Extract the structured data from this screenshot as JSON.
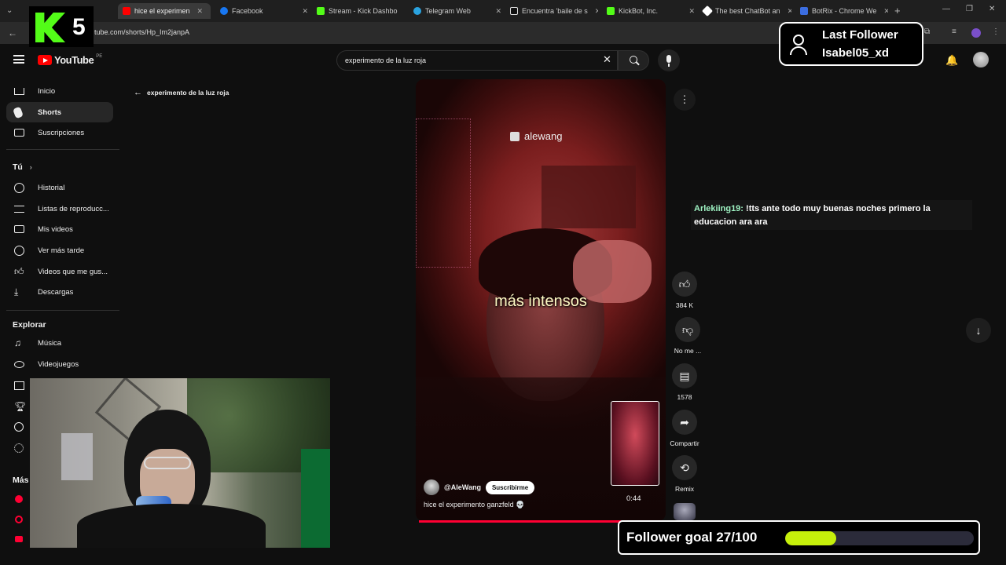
{
  "browser": {
    "tabs": [
      {
        "title": "hice el experimen",
        "active": true,
        "color": "#ff0000"
      },
      {
        "title": "Facebook",
        "active": false,
        "color": "#1877f2"
      },
      {
        "title": "Stream - Kick Dashbo",
        "active": false,
        "color": "#53fc18"
      },
      {
        "title": "Telegram Web",
        "active": false,
        "color": "#2aa3e0"
      },
      {
        "title": "Encuentra 'baile de s",
        "active": false,
        "color": "#111111"
      },
      {
        "title": "KickBot, Inc.",
        "active": false,
        "color": "#53fc18"
      },
      {
        "title": "The best ChatBot an",
        "active": false,
        "color": "#ffffff"
      },
      {
        "title": "BotRix - Chrome We",
        "active": false,
        "color": "#3b6de0"
      }
    ],
    "url": "tube.com/shorts/Hp_Im2janpA"
  },
  "header": {
    "logo_text": "YouTube",
    "logo_suffix": "PE",
    "search_value": "experimento de la luz roja"
  },
  "sidebar": {
    "items": [
      {
        "label": "Inicio",
        "icon": "home-icon"
      },
      {
        "label": "Shorts",
        "icon": "shorts-icon",
        "active": true
      },
      {
        "label": "Suscripciones",
        "icon": "subscriptions-icon"
      }
    ],
    "you_label": "Tú",
    "you_items": [
      {
        "label": "Historial",
        "icon": "history-icon"
      },
      {
        "label": "Listas de reproducc...",
        "icon": "playlist-icon"
      },
      {
        "label": "Mis videos",
        "icon": "my-videos-icon"
      },
      {
        "label": "Ver más tarde",
        "icon": "watch-later-icon"
      },
      {
        "label": "Videos que me gus...",
        "icon": "liked-icon"
      },
      {
        "label": "Descargas",
        "icon": "download-icon"
      }
    ],
    "explore_label": "Explorar",
    "explore_items": [
      {
        "label": "Música",
        "icon": "music-icon"
      },
      {
        "label": "Videojuegos",
        "icon": "gaming-icon"
      }
    ],
    "more_label": "Más"
  },
  "back_label": "experimento de la luz roja",
  "video": {
    "watermark": "alewang",
    "caption": "más intensos",
    "channel": "@AleWang",
    "subscribe_label": "Suscribirme",
    "title": "hice el experimento ganzfeld 💀",
    "progress": 0.83,
    "thumb_time": "0:44"
  },
  "actions": {
    "likes": "384 K",
    "dislike_label": "No me ...",
    "comments": "1578",
    "share_label": "Compartir",
    "remix_label": "Remix"
  },
  "overlay": {
    "kick_number": "5",
    "last_follower_title": "Last Follower",
    "last_follower_name": "Isabel05_xd",
    "chat_user": "Arlekiing19:",
    "chat_message": " !tts ante todo muy buenas noches primero la educacion ara ara",
    "goal_label": "Follower goal 27/100",
    "goal_progress": 0.27
  },
  "colors": {
    "kick_green": "#53fc18",
    "goal_fill": "#c6f00b",
    "chat_user": "#9ff3c3",
    "yt_red": "#ff0033"
  }
}
